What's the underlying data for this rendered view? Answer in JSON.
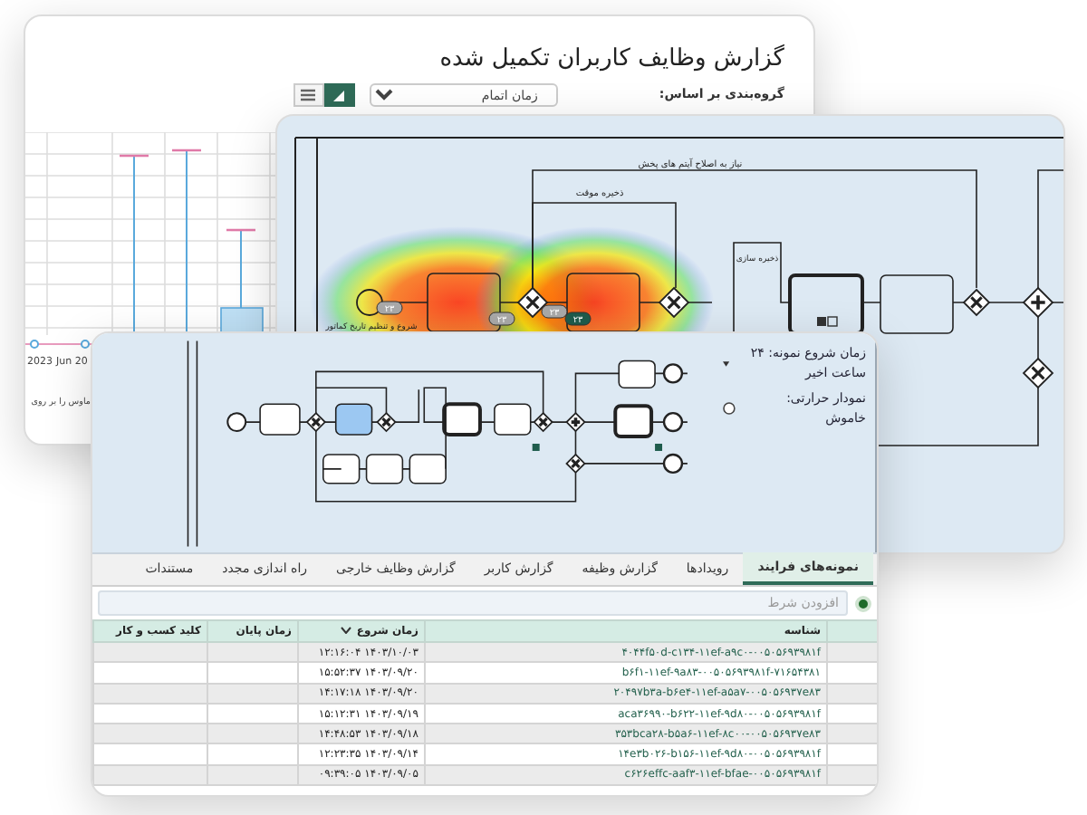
{
  "report_window": {
    "title": "گزارش وظایف کاربران تکمیل شده",
    "group_by_label": "گروه‌بندی بر اساس:",
    "group_by_select": {
      "value": "زمان اتمام"
    },
    "view_toggles": [
      {
        "kind": "chart",
        "selected": true
      },
      {
        "kind": "list",
        "selected": false
      }
    ],
    "axis_labels": [
      "Jun 20",
      "2023"
    ],
    "hint": "ماوس را بر روی"
  },
  "heatmap_window": {
    "labels": [
      {
        "text": "نیاز به اصلاح آیتم های پخش"
      },
      {
        "text": "ذخیره موقت"
      },
      {
        "text": "شروع و تنظیم تاریخ کماتور"
      },
      {
        "text": "ذخیره سازی"
      }
    ],
    "badges": [
      {
        "text": "۲۳",
        "highlighted": false
      },
      {
        "text": "۲۳",
        "highlighted": false
      },
      {
        "text": "۲۳",
        "highlighted": false
      },
      {
        "text": "۲۳",
        "highlighted": true
      }
    ]
  },
  "instances_window": {
    "time_filter": "زمان شروع نمونه: ۲۴ ساعت اخیر",
    "heatmap_toggle": {
      "label": "نمودار حرارتی: خاموش",
      "on": false
    },
    "tabs": [
      {
        "label": "نمونه‌های فرایند",
        "selected": true
      },
      {
        "label": "رویدادها",
        "selected": false
      },
      {
        "label": "گزارش وظیفه",
        "selected": false
      },
      {
        "label": "گزارش کاربر",
        "selected": false
      },
      {
        "label": "گزارش وظایف خارجی",
        "selected": false
      },
      {
        "label": "راه اندازی مجدد",
        "selected": false
      },
      {
        "label": "مستندات",
        "selected": false
      }
    ],
    "filter": {
      "placeholder": "افزودن شرط"
    },
    "table": {
      "columns": [
        {
          "label": "شناسه",
          "sorted": false
        },
        {
          "label": "زمان شروع",
          "sorted": true
        },
        {
          "label": "زمان پایان",
          "sorted": false
        },
        {
          "label": "کلید کسب و کار",
          "sorted": false
        }
      ],
      "rows": [
        {
          "id": "۴۰۴۴f۵۰d-c۱۳۴-۱۱ef-a۹c۰-۰۰۵۰۵۶۹۳۹۸۱f",
          "start": "۱۴۰۳/۱۰/۰۳ ۱۲:۱۶:۰۴"
        },
        {
          "id": "۷۱۶۵۴۳۸۱-b۶f۱-۱۱ef-۹a۸۳-۰۰۵۰۵۶۹۳۹۸۱f",
          "start": "۱۴۰۳/۰۹/۲۰ ۱۵:۵۲:۳۷"
        },
        {
          "id": "۲۰۴۹۷b۳a-b۶e۴-۱۱ef-a۵a۷-۰۰۵۰۵۶۹۳۷e۸۳",
          "start": "۱۴۰۳/۰۹/۲۰ ۱۴:۱۷:۱۸"
        },
        {
          "id": "aca۳۶۹۹۰-b۶۲۲-۱۱ef-۹d۸۰-۰۰۵۰۵۶۹۳۹۸۱f",
          "start": "۱۴۰۳/۰۹/۱۹ ۱۵:۱۲:۳۱"
        },
        {
          "id": "۳۵۳bca۲۸-b۵a۶-۱۱ef-۸c۰۰-۰۰۵۰۵۶۹۳۷e۸۳",
          "start": "۱۴۰۳/۰۹/۱۸ ۱۴:۴۸:۵۳"
        },
        {
          "id": "۱۴e۳b۰۲۶-b۱۵۶-۱۱ef-۹d۸۰-۰۰۵۰۵۶۹۳۹۸۱f",
          "start": "۱۴۰۳/۰۹/۱۴ ۱۲:۲۳:۳۵"
        },
        {
          "id": "c۶۲۶effc-aaf۳-۱۱ef-bfae-۰۰۵۰۵۶۹۳۹۸۱f",
          "start": "۱۴۰۳/۰۹/۰۵ ۰۹:۳۹:۰۵"
        }
      ]
    }
  }
}
